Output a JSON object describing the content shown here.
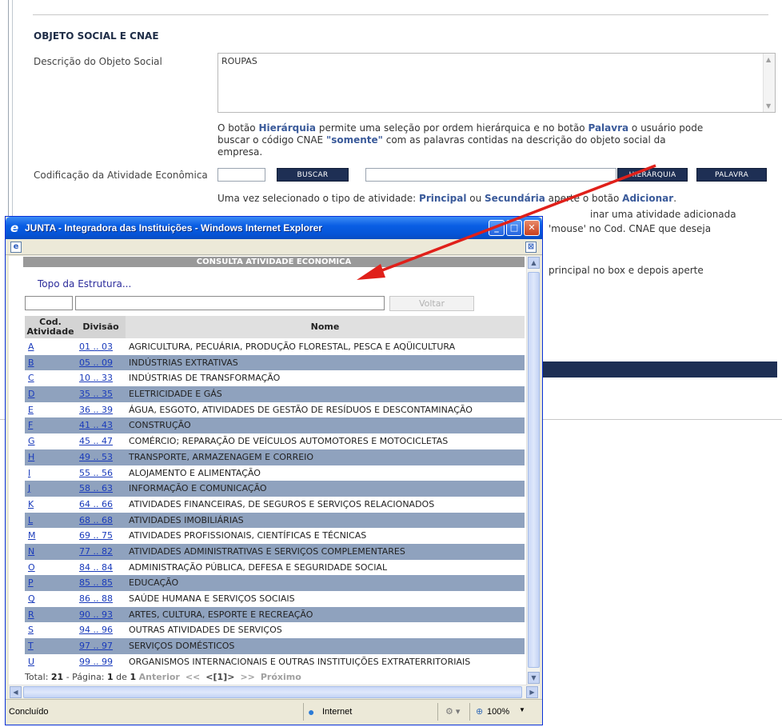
{
  "background_page": {
    "section_title": "OBJETO SOCIAL E CNAE",
    "descricao_label": "Descrição do Objeto Social",
    "descricao_value": "ROUPAS",
    "info_text_1": "O botão ",
    "info_hierarquia": "Hierárquia",
    "info_text_2": " permite uma seleção por ordem hierárquica e no botão ",
    "info_palavra": "Palavra",
    "info_text_3": " o usuário pode",
    "info_line2_a": "buscar o código CNAE ",
    "info_somente": "\"somente\"",
    "info_line2_b": " com as palavras contidas na descrição do objeto social da",
    "info_line3": "empresa.",
    "codificacao_label": "Codificação da Atividade Econômica",
    "buscar_button": "BUSCAR",
    "hierarquia_button": "HIERÁRQUIA",
    "palavra_button": "PALAVRA",
    "tipo_text_1": "Uma vez selecionado o tipo de atividade: ",
    "tipo_principal": "Principal",
    "tipo_text_2": " ou ",
    "tipo_secundaria": "Secundária",
    "tipo_text_3": " aperte o botão ",
    "tipo_adicionar": "Adicionar",
    "tipo_text_4": ".",
    "partial_line_2": "inar uma atividade adicionada",
    "partial_line_3": "'mouse' no Cod. CNAE que deseja",
    "partial_line_4": "principal no box e depois aperte"
  },
  "popup": {
    "window_title": "JUNTA - Integradora das Instituições - Windows Internet Explorer",
    "header": "CONSULTA ATIVIDADE ECONOMICA",
    "topo_link": "Topo da Estrutura...",
    "voltar_button": "Voltar",
    "columns": {
      "cod_line1": "Cod.",
      "cod_line2": "Atividade",
      "divisao": "Divisão",
      "nome": "Nome"
    },
    "rows": [
      {
        "cod": "A",
        "divisao": "01 .. 03",
        "nome": "AGRICULTURA, PECUÁRIA, PRODUÇÃO FLORESTAL, PESCA E AQÜICULTURA"
      },
      {
        "cod": "B",
        "divisao": "05 .. 09",
        "nome": "INDÚSTRIAS EXTRATIVAS"
      },
      {
        "cod": "C",
        "divisao": "10 .. 33",
        "nome": "INDÚSTRIAS DE TRANSFORMAÇÃO"
      },
      {
        "cod": "D",
        "divisao": "35 .. 35",
        "nome": "ELETRICIDADE E GÁS"
      },
      {
        "cod": "E",
        "divisao": "36 .. 39",
        "nome": "ÁGUA, ESGOTO, ATIVIDADES DE GESTÃO DE RESÍDUOS E DESCONTAMINAÇÃO"
      },
      {
        "cod": "F",
        "divisao": "41 .. 43",
        "nome": "CONSTRUÇÃO"
      },
      {
        "cod": "G",
        "divisao": "45 .. 47",
        "nome": "COMÉRCIO; REPARAÇÃO DE VEÍCULOS AUTOMOTORES E MOTOCICLETAS"
      },
      {
        "cod": "H",
        "divisao": "49 .. 53",
        "nome": "TRANSPORTE, ARMAZENAGEM E CORREIO"
      },
      {
        "cod": "I",
        "divisao": "55 .. 56",
        "nome": "ALOJAMENTO E ALIMENTAÇÃO"
      },
      {
        "cod": "J",
        "divisao": "58 .. 63",
        "nome": "INFORMAÇÃO E COMUNICAÇÃO"
      },
      {
        "cod": "K",
        "divisao": "64 .. 66",
        "nome": "ATIVIDADES FINANCEIRAS, DE SEGUROS E SERVIÇOS RELACIONADOS"
      },
      {
        "cod": "L",
        "divisao": "68 .. 68",
        "nome": "ATIVIDADES IMOBILIÁRIAS"
      },
      {
        "cod": "M",
        "divisao": "69 .. 75",
        "nome": "ATIVIDADES PROFISSIONAIS, CIENTÍFICAS E TÉCNICAS"
      },
      {
        "cod": "N",
        "divisao": "77 .. 82",
        "nome": "ATIVIDADES ADMINISTRATIVAS E SERVIÇOS COMPLEMENTARES"
      },
      {
        "cod": "O",
        "divisao": "84 .. 84",
        "nome": "ADMINISTRAÇÃO PÚBLICA, DEFESA E SEGURIDADE SOCIAL"
      },
      {
        "cod": "P",
        "divisao": "85 .. 85",
        "nome": "EDUCAÇÃO"
      },
      {
        "cod": "Q",
        "divisao": "86 .. 88",
        "nome": "SAÚDE HUMANA E SERVIÇOS SOCIAIS"
      },
      {
        "cod": "R",
        "divisao": "90 .. 93",
        "nome": "ARTES, CULTURA, ESPORTE E RECREAÇÃO"
      },
      {
        "cod": "S",
        "divisao": "94 .. 96",
        "nome": "OUTRAS ATIVIDADES DE SERVIÇOS"
      },
      {
        "cod": "T",
        "divisao": "97 .. 97",
        "nome": "SERVIÇOS DOMÉSTICOS"
      },
      {
        "cod": "U",
        "divisao": "99 .. 99",
        "nome": "ORGANISMOS INTERNACIONAIS E OUTRAS INSTITUIÇÕES EXTRATERRITORIAIS"
      }
    ],
    "pager": {
      "total_label": "Total:",
      "total": "21",
      "pagina_label": " - Página:",
      "page": "1",
      "de_label": " de ",
      "pages": "1",
      "anterior": "Anterior",
      "prev_symbol": "<<",
      "current_page": "<[1]>",
      "next_symbol": ">>",
      "proximo": "Próximo"
    },
    "status": {
      "text": "Concluído",
      "zone": "Internet",
      "zoom": "100%"
    }
  },
  "colors": {
    "accent_dark": "#1e2f54",
    "row_alt": "#8fa2be",
    "annotation_arrow": "#e0201a",
    "ie_titlebar": "#0553d6"
  },
  "icons": [
    "ie-logo-icon",
    "page-icon",
    "minimize-icon",
    "maximize-icon",
    "close-icon",
    "globe-icon",
    "zoom-icon"
  ]
}
